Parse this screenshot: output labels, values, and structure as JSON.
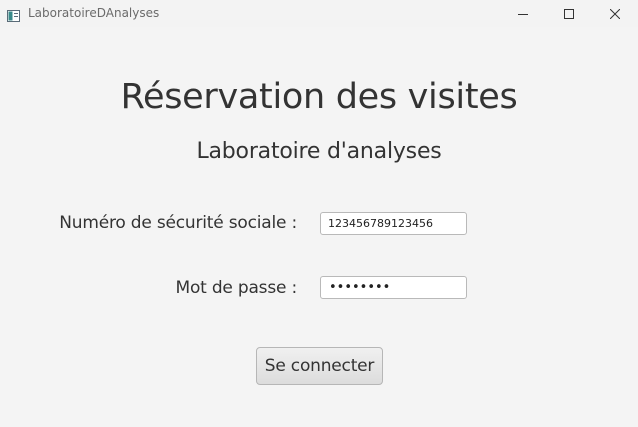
{
  "window": {
    "title": "LaboratoireDAnalyses",
    "icon": "java-app-icon",
    "controls": [
      "minimize-icon",
      "maximize-icon",
      "close-icon"
    ]
  },
  "main": {
    "heading": "Réservation des visites",
    "subheading": "Laboratoire d'analyses"
  },
  "form": {
    "nss_label": "Numéro de sécurité sociale :",
    "nss_value": "123456789123456",
    "password_label": "Mot de passe :",
    "password_masked": "••••••••",
    "submit_label": "Se connecter"
  }
}
